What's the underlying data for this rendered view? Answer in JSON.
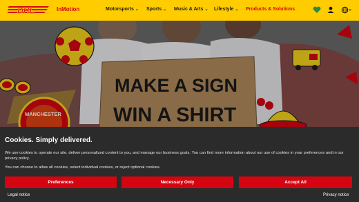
{
  "header": {
    "logo_text": "DHL",
    "brand_sub": "InMotion",
    "nav": [
      {
        "label": "Motorsports"
      },
      {
        "label": "Sports"
      },
      {
        "label": "Music & Arts"
      },
      {
        "label": "Lifestyle"
      },
      {
        "label": "Products & Solutions"
      }
    ],
    "icons": [
      "heart-icon",
      "user-icon",
      "globe-icon"
    ]
  },
  "hero": {
    "sign_line1": "MAKE A SIGN",
    "sign_line2": "WIN A SHIRT",
    "badge_text": "MANCHESTER"
  },
  "cookie": {
    "title": "Cookies. Simply delivered.",
    "text1": "We use cookies to operate our site, deliver personalized content to you, and manage our business goals. You can find more information about our use of cookies in your preferences and in our privacy policy.",
    "text2": "You can choose to allow all cookies, select individual cookies, or reject optional cookies.",
    "preferences": "Preferences",
    "necessary": "Necessary Only",
    "accept": "Accept All",
    "legal": "Legal notice",
    "privacy": "Privacy notice"
  },
  "colors": {
    "dhl_yellow": "#ffcc00",
    "dhl_red": "#d40511",
    "banner_bg": "#2b2b2b"
  }
}
